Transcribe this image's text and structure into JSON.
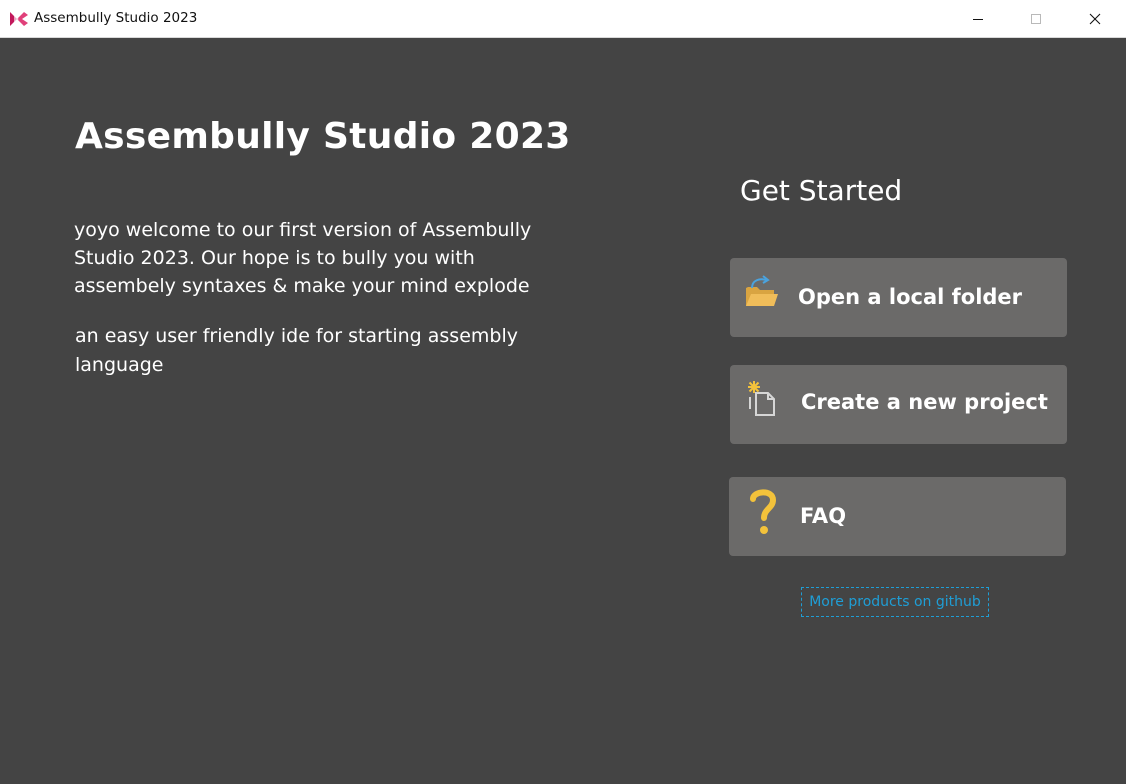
{
  "window": {
    "title": "Assembully Studio 2023",
    "logo_icon": "assembully-logo-icon",
    "controls": [
      "minimize-icon",
      "maximize-icon",
      "close-icon"
    ]
  },
  "main": {
    "heading": "Assembully Studio 2023",
    "intro": "yoyo welcome to our first version of Assembully Studio 2023. Our hope is to bully you with assembely syntaxes & make your mind explode",
    "tagline": "an easy user friendly ide for starting assembly language"
  },
  "sidebar": {
    "title": "Get Started",
    "actions": [
      {
        "label": "Open a local folder",
        "icon": "open-folder-icon"
      },
      {
        "label": "Create a new project",
        "icon": "new-project-icon"
      },
      {
        "label": "FAQ",
        "icon": "question-mark-icon"
      }
    ],
    "more_link": "More products on github"
  },
  "colors": {
    "background": "#444444",
    "button": "#6b6a69",
    "link": "#1f9ed6",
    "faq_accent": "#f3c23b",
    "logo": "#c2185b"
  }
}
